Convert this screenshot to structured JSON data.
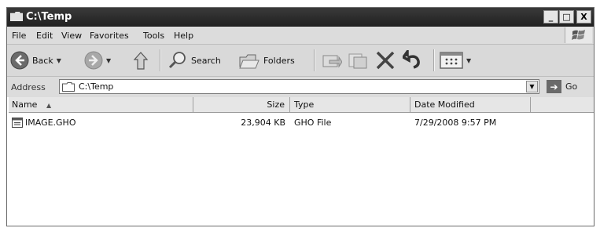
{
  "window": {
    "title": "C:\\Temp"
  },
  "title_buttons": {
    "minimize": "_",
    "maximize": "□",
    "close": "X"
  },
  "menu": {
    "items": [
      "File",
      "Edit",
      "View",
      "Favorites",
      "Tools",
      "Help"
    ]
  },
  "toolbar": {
    "back_label": "Back",
    "search_label": "Search",
    "folders_label": "Folders"
  },
  "address": {
    "label": "Address",
    "value": "C:\\Temp",
    "go_label": "Go"
  },
  "columns": {
    "name": "Name",
    "size": "Size",
    "type": "Type",
    "date": "Date Modified"
  },
  "files": [
    {
      "name": "IMAGE.GHO",
      "size": "23,904 KB",
      "type": "GHO File",
      "date": "7/29/2008 9:57 PM"
    }
  ],
  "icons": {
    "title": "folder-icon",
    "back": "back-arrow-icon",
    "forward": "forward-arrow-icon",
    "up": "up-folder-icon",
    "search": "search-icon",
    "folders": "folders-icon",
    "move_to": "move-to-icon",
    "copy_to": "copy-to-icon",
    "delete": "delete-icon",
    "undo": "undo-icon",
    "views": "views-icon",
    "go": "go-arrow-icon",
    "file": "file-icon",
    "windows_logo": "windows-logo-icon"
  }
}
